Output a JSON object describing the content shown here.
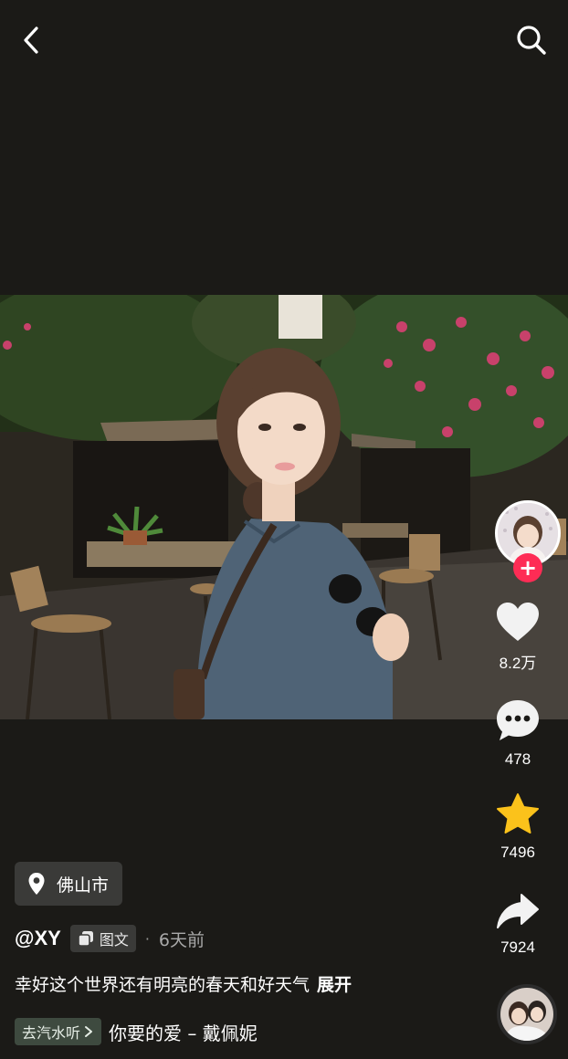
{
  "header": {
    "back_icon": "chevron-left-icon",
    "search_icon": "search-icon"
  },
  "side_actions": {
    "like_count": "8.2万",
    "comment_count": "478",
    "favorite_count": "7496",
    "share_count": "7924",
    "follow_symbol": "+",
    "favorite_color": "#fbc21b",
    "follow_color": "#fe2c55"
  },
  "post": {
    "location": "佛山市",
    "username": "@XY",
    "type_label": "图文",
    "separator": "·",
    "time": "6天前",
    "caption": "幸好这个世界还有明亮的春天和好天气",
    "expand_label": "展开"
  },
  "music": {
    "go_listen_label": "去汽水听",
    "song": "你要的爱 – 戴佩妮"
  }
}
